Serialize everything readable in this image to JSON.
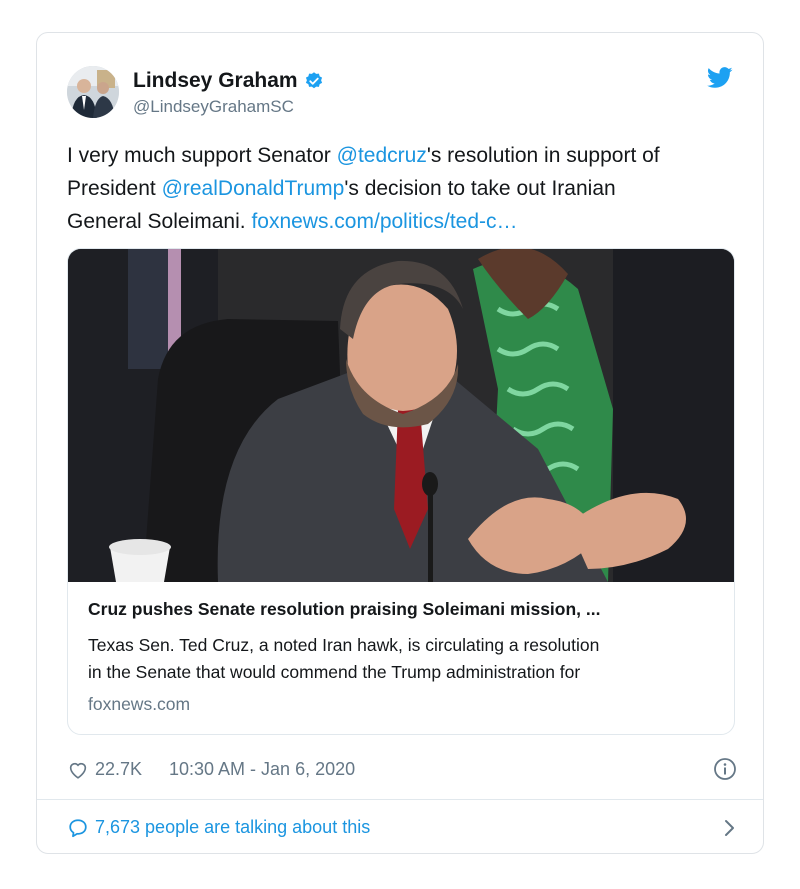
{
  "author": {
    "name": "Lindsey Graham",
    "handle": "@LindseyGrahamSC",
    "verified": true,
    "avatar_icon": "profile-photo"
  },
  "tweet": {
    "parts": [
      {
        "text": "I very much support Senator ",
        "type": "text"
      },
      {
        "text": "@tedcruz",
        "type": "mention"
      },
      {
        "text": "'s resolution in support of",
        "type": "text"
      },
      {
        "text": "President ",
        "type": "text"
      },
      {
        "text": "@realDonaldTrump",
        "type": "mention"
      },
      {
        "text": "'s decision to take out Iranian",
        "type": "text"
      },
      {
        "text": "General Soleimani.  ",
        "type": "text"
      },
      {
        "text": "foxnews.com/politics/ted-c…",
        "type": "link"
      }
    ]
  },
  "link_card": {
    "title": "Cruz pushes Senate resolution praising Soleimani mission, ...",
    "description_line1": "Texas Sen. Ted Cruz, a noted Iran hawk, is circulating a resolution",
    "description_line2": "in the Senate that would commend the Trump administration for",
    "domain": "foxnews.com"
  },
  "meta": {
    "likes": "22.7K",
    "timestamp": "10:30 AM - Jan 6, 2020"
  },
  "conversation": {
    "label": "7,673 people are talking about this"
  },
  "colors": {
    "link": "#1b95e0",
    "text": "#14171a",
    "secondary": "#657786",
    "twitter_blue": "#1da1f2"
  }
}
